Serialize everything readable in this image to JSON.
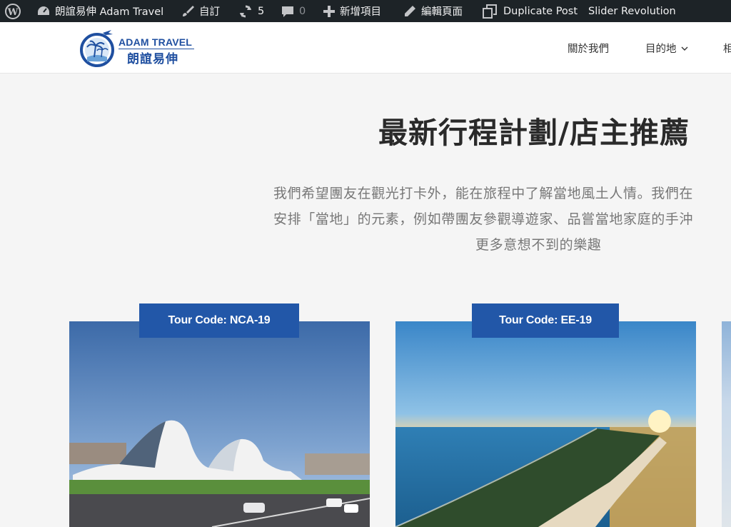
{
  "admin_bar": {
    "site_name": "朗誼易伸 Adam Travel",
    "customize": "自訂",
    "updates_count": "5",
    "comments_count": "0",
    "new_item": "新增項目",
    "edit_page": "編輯頁面",
    "duplicate_post": "Duplicate Post",
    "slider_revolution": "Slider Revolution"
  },
  "header": {
    "logo_en": "ADAM TRAVEL",
    "logo_zh": "朗誼易伸",
    "nav": [
      "關於我們",
      "目的地",
      "相"
    ]
  },
  "main": {
    "title": "最新行程計劃/店主推薦",
    "paragraph_lines": [
      "我們希望團友在觀光打卡外，能在旅程中了解當地風土人情。我們在",
      "安排「當地」的元素，例如帶團友參觀導遊家、品嘗當地家庭的手沖",
      "更多意想不到的樂趣"
    ]
  },
  "tours": [
    {
      "code": "Tour Code: NCA-19",
      "image": "heydar-aliyev-center-photo"
    },
    {
      "code": "Tour Code: EE-19",
      "image": "coastal-spit-sunset-photo"
    }
  ],
  "colors": {
    "admin_bar": "#1d2327",
    "brand_blue": "#1f4fa0",
    "badge_blue": "#2257a8"
  }
}
